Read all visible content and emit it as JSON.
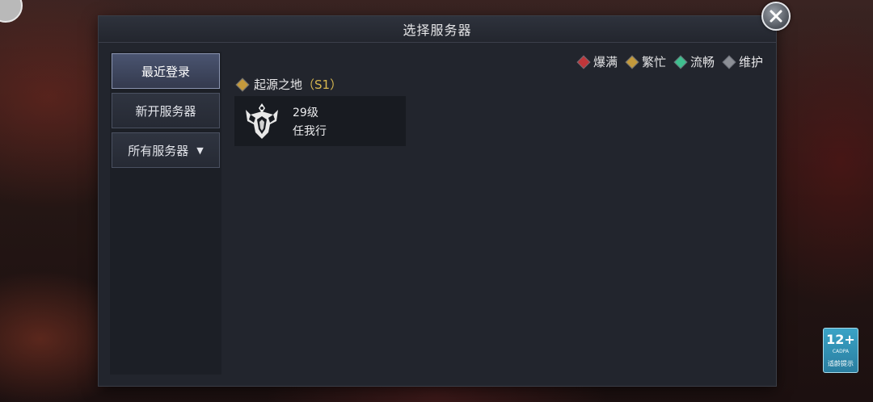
{
  "modal": {
    "title": "选择服务器",
    "close_icon": "close-x-icon"
  },
  "sidebar": {
    "items": [
      {
        "label": "最近登录",
        "active": true
      },
      {
        "label": "新开服务器",
        "active": false
      },
      {
        "label": "所有服务器",
        "active": false,
        "icon": "caret-down-icon"
      }
    ]
  },
  "legend": [
    {
      "label": "爆满",
      "color": "#c0363a"
    },
    {
      "label": "繁忙",
      "color": "#c49a3c"
    },
    {
      "label": "流畅",
      "color": "#3fbf8f"
    },
    {
      "label": "维护",
      "color": "#8c8f96"
    }
  ],
  "server_group": {
    "name": "起源之地",
    "code": "（S1）",
    "color": "#c49a3c"
  },
  "server_card": {
    "emblem": "class-emblem-icon",
    "level": "29级",
    "role_name": "任我行"
  },
  "age_rating": {
    "age": "12+",
    "org": "CADPA",
    "note": "适龄提示"
  }
}
